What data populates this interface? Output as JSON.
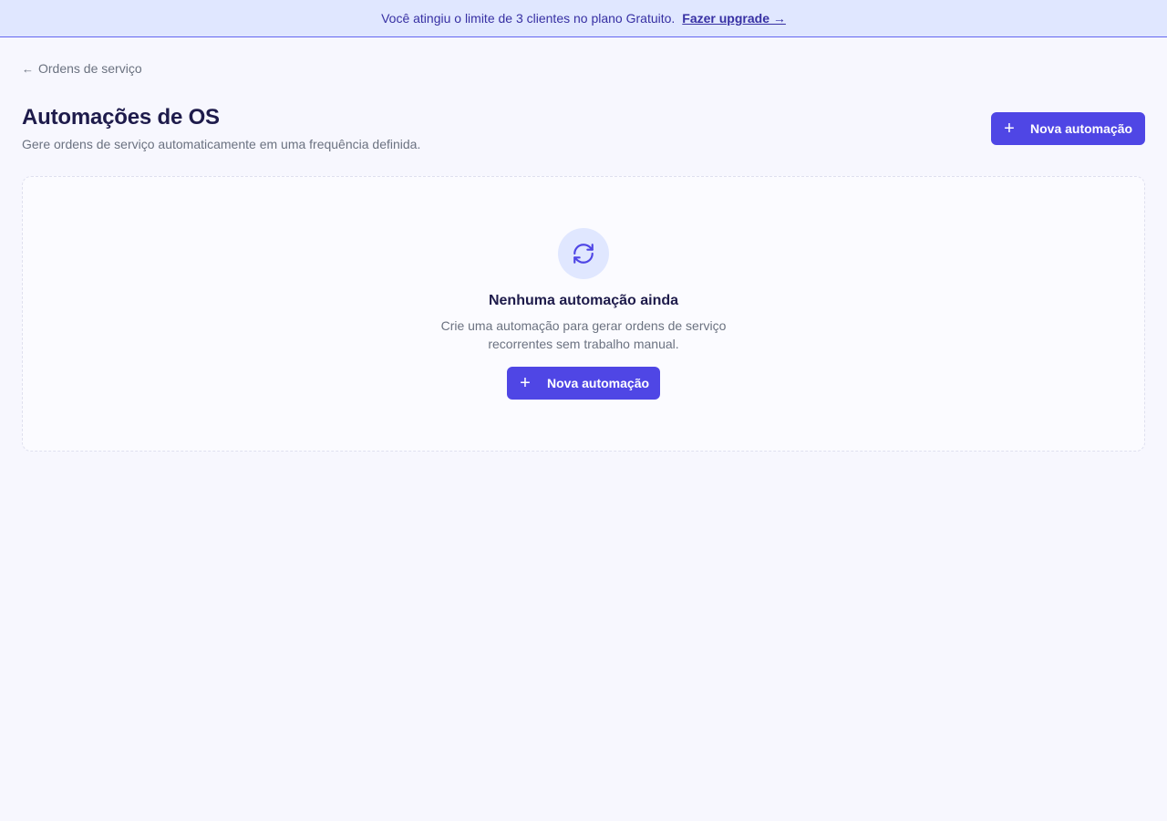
{
  "banner": {
    "message": "Você atingiu o limite de 3 clientes no plano Gratuito.",
    "link_label": "Fazer upgrade →"
  },
  "breadcrumb": {
    "back_label": "Ordens de serviço"
  },
  "header": {
    "title": "Automações de OS",
    "subtitle": "Gere ordens de serviço automaticamente em uma frequência definida.",
    "new_button_label": "Nova automação"
  },
  "empty_state": {
    "icon": "refresh-icon",
    "title": "Nenhuma automação ainda",
    "description_line1": "Crie uma automação para gerar ordens de serviço",
    "description_line2": "recorrentes sem trabalho manual.",
    "button_label": "Nova automação"
  },
  "colors": {
    "accent": "#4f46e5",
    "banner_bg": "#e0e7ff",
    "banner_text": "#3730a3",
    "page_bg": "#f7f7fe"
  }
}
